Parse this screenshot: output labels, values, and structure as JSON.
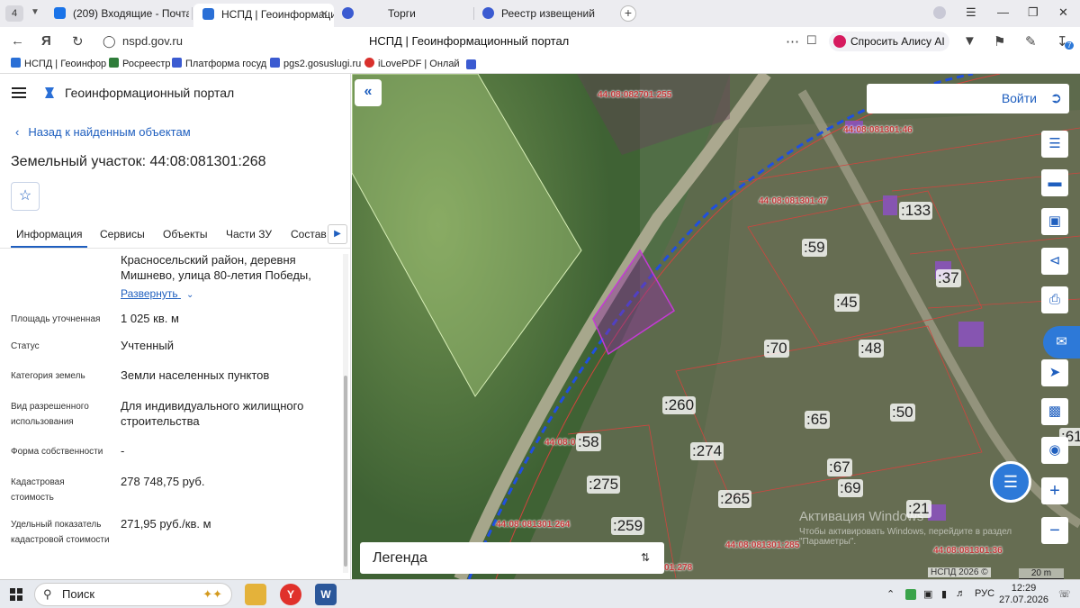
{
  "browser": {
    "tab_counter": "4",
    "tabs": [
      {
        "label": "(209) Входящие - Почта",
        "color": "#1a73e8"
      },
      {
        "label": "НСПД | Геоинформацио",
        "color": "#2a6fd6"
      },
      {
        "label": "Торги",
        "color": "#3b5bd1"
      },
      {
        "label": "Реестр извещений",
        "color": "#3b5bd1"
      }
    ],
    "url": "nspd.gov.ru",
    "page_title": "НСПД | Геоинформационный портал",
    "alice_label": "Спросить Алису AI",
    "download_badge": "7",
    "bookmarks": [
      {
        "label": "НСПД | Геоинфор",
        "color": "#2a6fd6"
      },
      {
        "label": "Росреестр",
        "color": "#2f7d3a"
      },
      {
        "label": "Платформа госуд",
        "color": "#3b5bd1"
      },
      {
        "label": "pgs2.gosuslugi.ru",
        "color": "#3b5bd1"
      },
      {
        "label": "iLovePDF | Онлай",
        "color": "#d9302c"
      }
    ]
  },
  "panel": {
    "portal_title": "Геоинформационный портал",
    "back_link": "Назад к найденным объектам",
    "object_title": "Земельный участок: 44:08:081301:268",
    "tabs": [
      "Информация",
      "Сервисы",
      "Объекты",
      "Части ЗУ",
      "Состав"
    ],
    "address_lines": [
      "Красносельский район, деревня",
      "Мишнево, улица 80-летия Победы,"
    ],
    "expand_link": "Развернуть",
    "fields": [
      {
        "label": "Площадь уточненная",
        "value": "1 025 кв. м"
      },
      {
        "label": "Статус",
        "value": "Учтенный"
      },
      {
        "label": "Категория земель",
        "value": "Земли населенных пунктов"
      },
      {
        "label": "Вид разрешенного использования",
        "value": "Для индивидуального жилищного строительства"
      },
      {
        "label": "Форма собственности",
        "value": "-"
      },
      {
        "label": "Кадастровая стоимость",
        "value": "278 748,75 руб."
      },
      {
        "label": "Удельный показатель кадастровой стоимости",
        "value": "271,95 руб./кв. м"
      }
    ]
  },
  "map": {
    "login_label": "Войти",
    "legend_label": "Легенда",
    "parcel_labels": [
      ":133",
      ":59",
      ":37",
      ":45",
      ":70",
      ":48",
      ":260",
      ":65",
      ":50",
      ":58",
      ":274",
      ":67",
      ":275",
      ":69",
      ":265",
      ":21",
      ":259",
      ":61"
    ],
    "cadastral_labels": [
      "44:08:082701:255",
      "44:08:081301:46",
      "44:08:081301:47",
      "44:08:0",
      "44:08:081301:264",
      "44:08:081301:285",
      "44:08:081301:36",
      "01:278"
    ],
    "watermark_title": "Активация Windows",
    "watermark_text": "Чтобы активировать Windows, перейдите в раздел \"Параметры\".",
    "attribution": "НСПД 2026 ©",
    "scale": "20 m",
    "accent_color": "#2d79d8",
    "selected_parcel_color": "#9b2fa8",
    "road_boundary_color": "#1f4fe0"
  },
  "taskbar": {
    "search_label": "Поиск",
    "language": "РУС",
    "time": "12:29",
    "date": "27.07.2026"
  }
}
